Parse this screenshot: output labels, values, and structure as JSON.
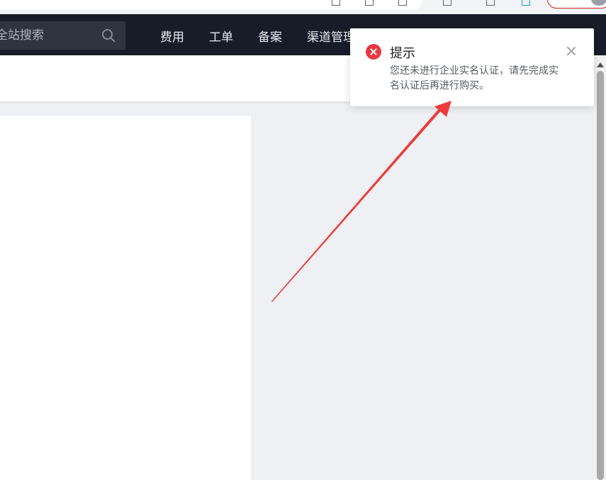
{
  "search": {
    "placeholder": "全站搜索"
  },
  "nav": {
    "items": [
      "费用",
      "工单",
      "备案",
      "渠道管理"
    ]
  },
  "notification": {
    "title": "提示",
    "message": "您还未进行企业实名认证，请先完成实名认证后再进行购买。",
    "status": "error"
  },
  "colors": {
    "nav_background": "#181c28",
    "error": "#e9383f",
    "annotation_arrow": "#ee3b3b",
    "content_background": "#eef0f3"
  },
  "icons": [
    "search-icon",
    "error-icon",
    "close-icon",
    "annotation-arrow"
  ]
}
